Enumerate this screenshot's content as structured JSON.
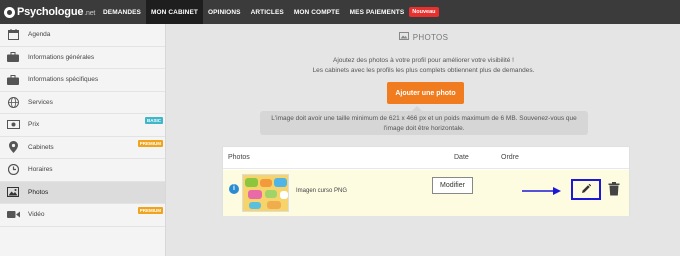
{
  "brand": {
    "name": "Psychologue",
    "suffix": ".net"
  },
  "nav": {
    "items": [
      {
        "label": "DEMANDES"
      },
      {
        "label": "MON CABINET",
        "active": true
      },
      {
        "label": "OPINIONS"
      },
      {
        "label": "ARTICLES"
      },
      {
        "label": "MON COMPTE"
      },
      {
        "label": "MES PAIEMENTS"
      }
    ],
    "new_badge": "Nouveau"
  },
  "sidebar": {
    "items": [
      {
        "label": "Agenda",
        "icon": "calendar-icon"
      },
      {
        "label": "Informations générales",
        "icon": "briefcase-icon"
      },
      {
        "label": "Informations spécifiques",
        "icon": "briefcase-icon"
      },
      {
        "label": "Services",
        "icon": "globe-icon"
      },
      {
        "label": "Prix",
        "icon": "banknote-icon",
        "tag": "BASIC"
      },
      {
        "label": "Cabinets",
        "icon": "map-pin-icon",
        "tag": "PREMIUM"
      },
      {
        "label": "Horaires",
        "icon": "clock-icon"
      },
      {
        "label": "Photos",
        "icon": "photo-icon",
        "active": true
      },
      {
        "label": "Vidéo",
        "icon": "video-icon",
        "tag": "PREMIUM"
      }
    ]
  },
  "main": {
    "title": "PHOTOS",
    "intro_line1": "Ajoutez des photos à votre profil pour améliorer votre visibilité !",
    "intro_line2": "Les cabinets avec les profils les plus complets obtiennent plus de demandes.",
    "add_button": "Ajouter une photo",
    "info_line1": "L'image doit avoir une taille minimum de 621 x 466 px et un poids maximum de 6 MB. Souvenez-vous que",
    "info_line2": "l'image doit être horizontale.",
    "table": {
      "headers": {
        "photos": "Photos",
        "date": "Date",
        "ordre": "Ordre"
      },
      "rows": [
        {
          "name": "Imagen curso PNG"
        }
      ]
    },
    "tooltip": "Modifier"
  },
  "colors": {
    "nav_bg": "#3b3b3b",
    "accent_orange": "#f07c1f",
    "new_badge": "#e8312f",
    "basic_tag": "#3fb7c9",
    "premium_tag": "#f0a31c",
    "highlight_box": "#1d18d6",
    "row_bg": "#fdfbe0"
  }
}
